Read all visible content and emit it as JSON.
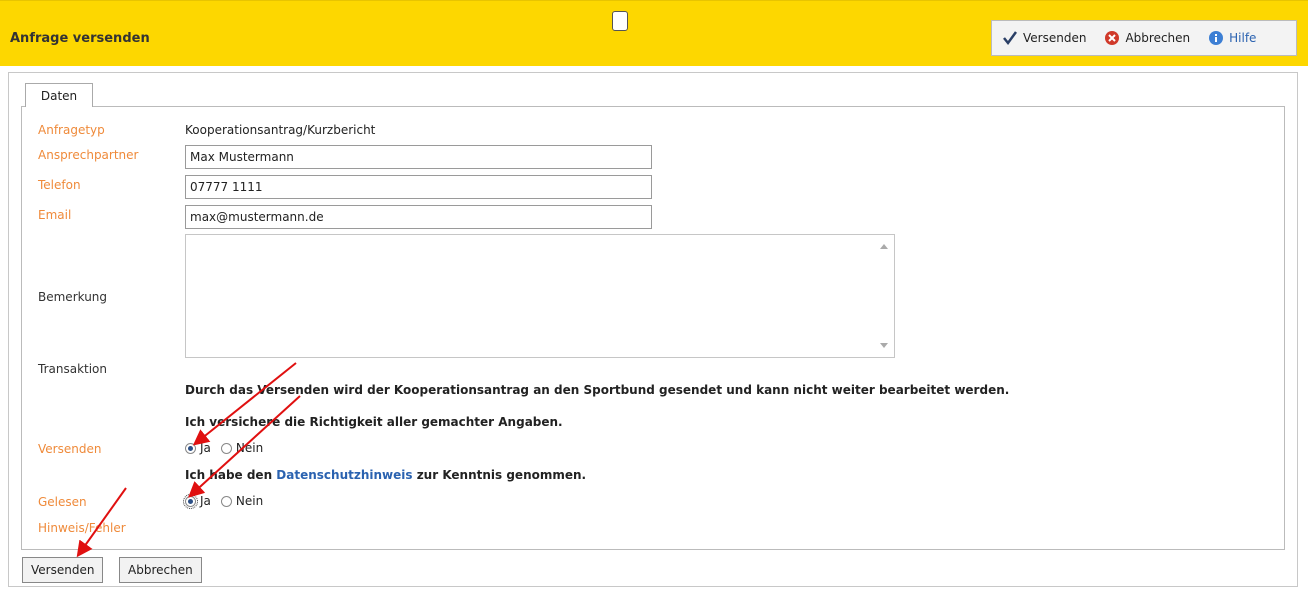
{
  "header": {
    "title": "Anfrage versenden",
    "toolbar": {
      "send": "Versenden",
      "cancel": "Abbrechen",
      "help": "Hilfe"
    }
  },
  "tabs": [
    "Daten"
  ],
  "form": {
    "anfragetyp_label": "Anfragetyp",
    "anfragetyp_value": "Kooperationsantrag/Kurzbericht",
    "ansprechpartner_label": "Ansprechpartner",
    "ansprechpartner_value": "Max Mustermann",
    "telefon_label": "Telefon",
    "telefon_value": "07777 1111",
    "email_label": "Email",
    "email_value": "max@mustermann.de",
    "bemerkung_label": "Bemerkung",
    "transaktion_label": "Transaktion",
    "transaktion_text": "Durch das Versenden wird der Kooperationsantrag an den Sportbund gesendet und kann nicht weiter bearbeitet werden.",
    "versichere_text": "Ich versichere die Richtigkeit aller gemachter Angaben.",
    "versenden_label": "Versenden",
    "ja": "Ja",
    "nein": "Nein",
    "datenschutz_pre": "Ich habe den ",
    "datenschutz_link": "Datenschutzhinweis",
    "datenschutz_post": " zur Kenntnis genommen.",
    "gelesen_label": "Gelesen",
    "hinweis_label": "Hinweis/Fehler",
    "versenden_selected": "Ja",
    "gelesen_selected": "Ja"
  },
  "buttons": {
    "send": "Versenden",
    "cancel": "Abbrechen"
  },
  "colors": {
    "header_bg": "#fdd700",
    "label_orange": "#ef8a3a",
    "link_blue": "#2a62b0",
    "annotation_red": "#e01010"
  }
}
